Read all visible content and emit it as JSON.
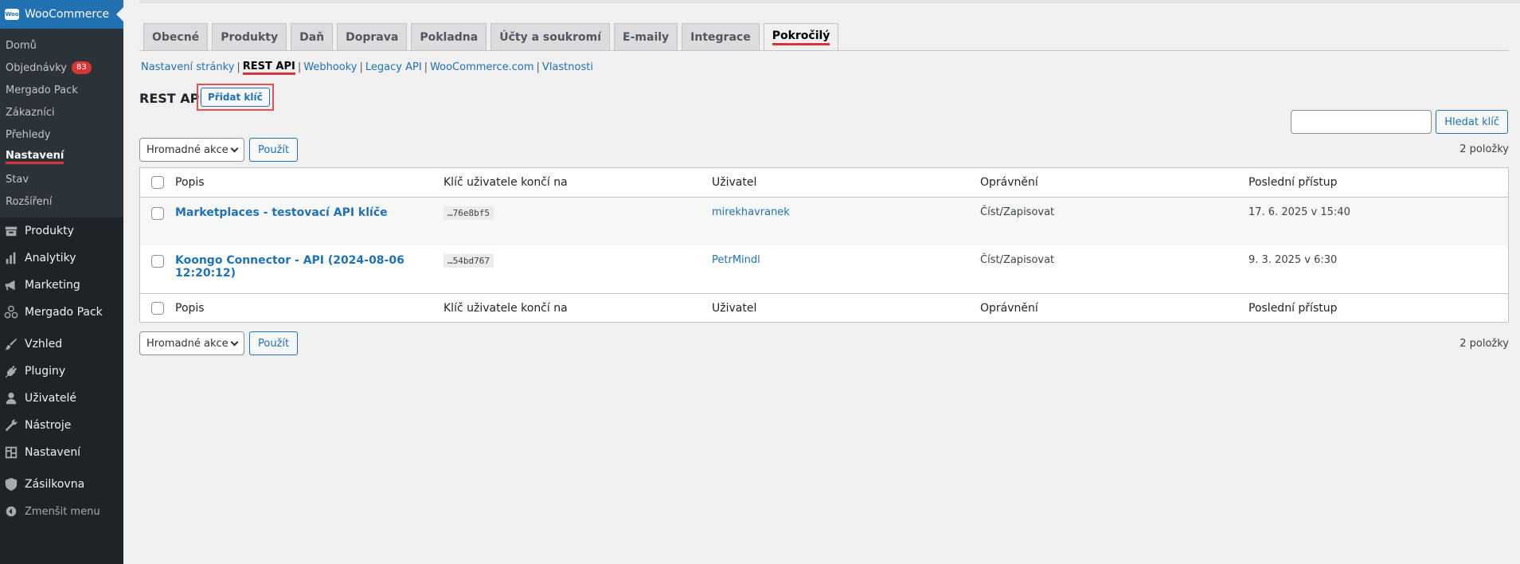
{
  "sidebar": {
    "plugin_title": "WooCommerce",
    "logo_text": "Woo",
    "submenu": [
      {
        "label": "Domů"
      },
      {
        "label": "Objednávky",
        "badge": "83"
      },
      {
        "label": "Mergado Pack"
      },
      {
        "label": "Zákazníci"
      },
      {
        "label": "Přehledy"
      },
      {
        "label": "Nastavení",
        "current": true
      },
      {
        "label": "Stav"
      },
      {
        "label": "Rozšíření"
      }
    ],
    "menu": [
      {
        "label": "Produkty",
        "icon": "archive-icon"
      },
      {
        "label": "Analytiky",
        "icon": "bar-chart-icon"
      },
      {
        "label": "Marketing",
        "icon": "megaphone-icon"
      },
      {
        "label": "Mergado Pack",
        "icon": "hexagon-cluster-icon"
      },
      {
        "label": "Vzhled",
        "icon": "brush-icon"
      },
      {
        "label": "Pluginy",
        "icon": "plug-icon"
      },
      {
        "label": "Uživatelé",
        "icon": "user-icon"
      },
      {
        "label": "Nástroje",
        "icon": "wrench-icon"
      },
      {
        "label": "Nastavení",
        "icon": "sliders-icon"
      },
      {
        "label": "Zásilkovna",
        "icon": "shield-icon"
      }
    ],
    "collapse_label": "Zmenšit menu"
  },
  "tabs": [
    {
      "label": "Obecné"
    },
    {
      "label": "Produkty"
    },
    {
      "label": "Daň"
    },
    {
      "label": "Doprava"
    },
    {
      "label": "Pokladna"
    },
    {
      "label": "Účty a soukromí"
    },
    {
      "label": "E-maily"
    },
    {
      "label": "Integrace"
    },
    {
      "label": "Pokročilý",
      "active": true
    }
  ],
  "subsections": [
    {
      "label": "Nastavení stránky"
    },
    {
      "label": "REST API",
      "current": true
    },
    {
      "label": "Webhooky"
    },
    {
      "label": "Legacy API"
    },
    {
      "label": "WooCommerce.com"
    },
    {
      "label": "Vlastnosti"
    }
  ],
  "page": {
    "title": "REST API",
    "add_key_label": "Přidat klíč",
    "search_button": "Hledat klíč",
    "search_value": "",
    "bulk_select": "Hromadné akce",
    "apply_button": "Použít",
    "items_count": "2 položky"
  },
  "table": {
    "columns": [
      "Popis",
      "Klíč uživatele končí na",
      "Uživatel",
      "Oprávnění",
      "Poslední přístup"
    ],
    "rows": [
      {
        "description": "Marketplaces - testovací API klíče",
        "key_end": "…76e8bf5",
        "user": "mirekhavranek",
        "permissions": "Číst/Zapisovat",
        "last_access": "17. 6. 2025 v 15:40"
      },
      {
        "description": "Koongo Connector - API (2024-08-06 12:20:12)",
        "key_end": "…54bd767",
        "user": "PetrMindl",
        "permissions": "Číst/Zapisovat",
        "last_access": "9. 3. 2025 v 6:30"
      }
    ]
  },
  "colors": {
    "sidebar_bg": "#1d2327",
    "accent": "#2271b1",
    "highlight": "#d63638"
  }
}
